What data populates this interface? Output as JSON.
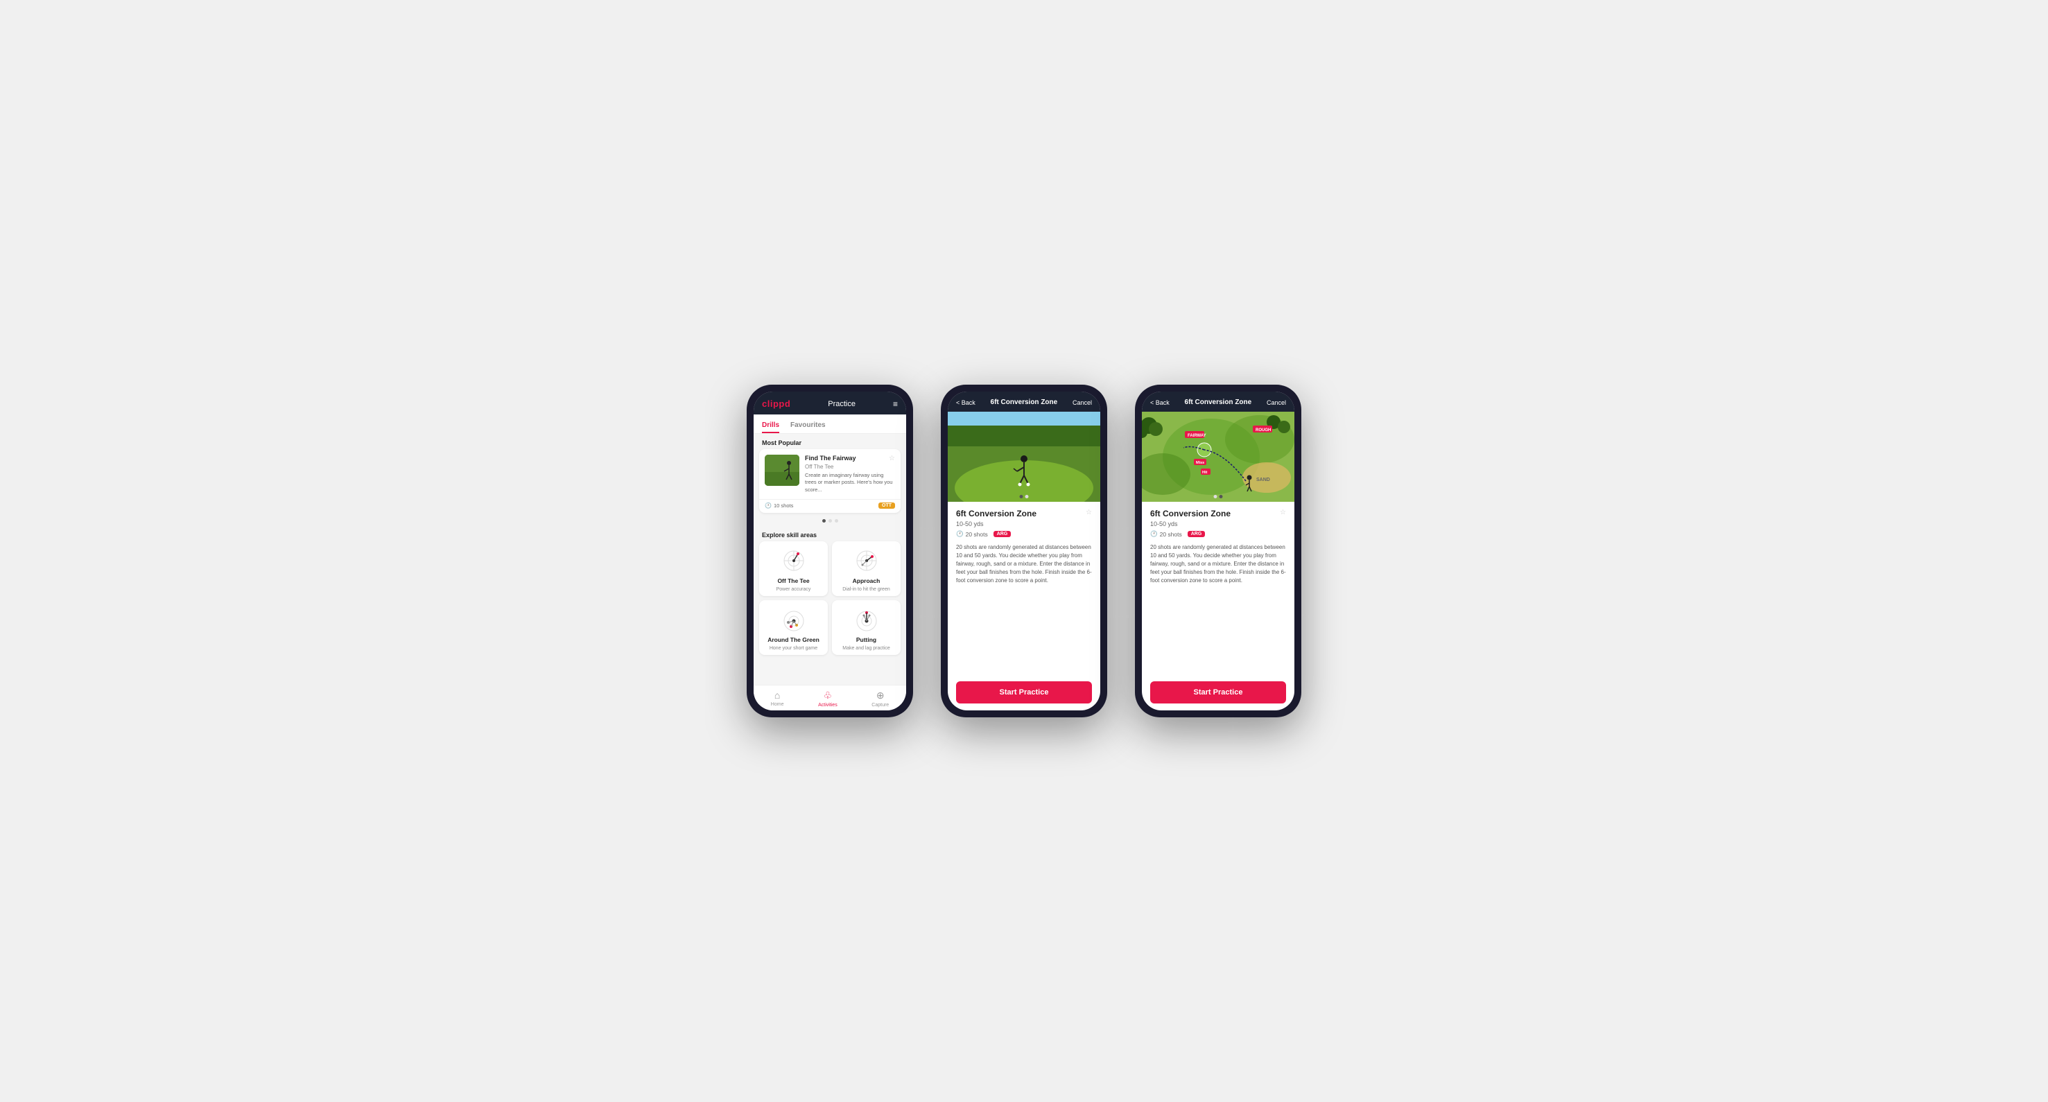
{
  "app": {
    "logo": "clippd",
    "header_title": "Practice",
    "menu_icon": "≡"
  },
  "phone1": {
    "tabs": [
      {
        "label": "Drills",
        "active": true
      },
      {
        "label": "Favourites",
        "active": false
      }
    ],
    "most_popular_label": "Most Popular",
    "drill_card": {
      "title": "Find The Fairway",
      "subtitle": "Off The Tee",
      "desc": "Create an imaginary fairway using trees or marker posts. Here's how you score...",
      "shots": "10 shots",
      "tag": "OTT"
    },
    "explore_label": "Explore skill areas",
    "skills": [
      {
        "name": "Off The Tee",
        "desc": "Power accuracy"
      },
      {
        "name": "Approach",
        "desc": "Dial-in to hit the green"
      },
      {
        "name": "Around The Green",
        "desc": "Hone your short game"
      },
      {
        "name": "Putting",
        "desc": "Make and lag practice"
      }
    ],
    "nav": [
      {
        "label": "Home",
        "icon": "⌂",
        "active": false
      },
      {
        "label": "Activities",
        "icon": "♧",
        "active": true
      },
      {
        "label": "Capture",
        "icon": "⊕",
        "active": false
      }
    ]
  },
  "phone2": {
    "back_label": "< Back",
    "header_title": "6ft Conversion Zone",
    "cancel_label": "Cancel",
    "image_type": "photo",
    "drill_title": "6ft Conversion Zone",
    "drill_range": "10-50 yds",
    "shots": "20 shots",
    "tag": "ARG",
    "description": "20 shots are randomly generated at distances between 10 and 50 yards. You decide whether you play from fairway, rough, sand or a mixture. Enter the distance in feet your ball finishes from the hole. Finish inside the 6-foot conversion zone to score a point.",
    "start_btn": "Start Practice"
  },
  "phone3": {
    "back_label": "< Back",
    "header_title": "6ft Conversion Zone",
    "cancel_label": "Cancel",
    "image_type": "map",
    "drill_title": "6ft Conversion Zone",
    "drill_range": "10-50 yds",
    "shots": "20 shots",
    "tag": "ARG",
    "description": "20 shots are randomly generated at distances between 10 and 50 yards. You decide whether you play from fairway, rough, sand or a mixture. Enter the distance in feet your ball finishes from the hole. Finish inside the 6-foot conversion zone to score a point.",
    "start_btn": "Start Practice"
  }
}
